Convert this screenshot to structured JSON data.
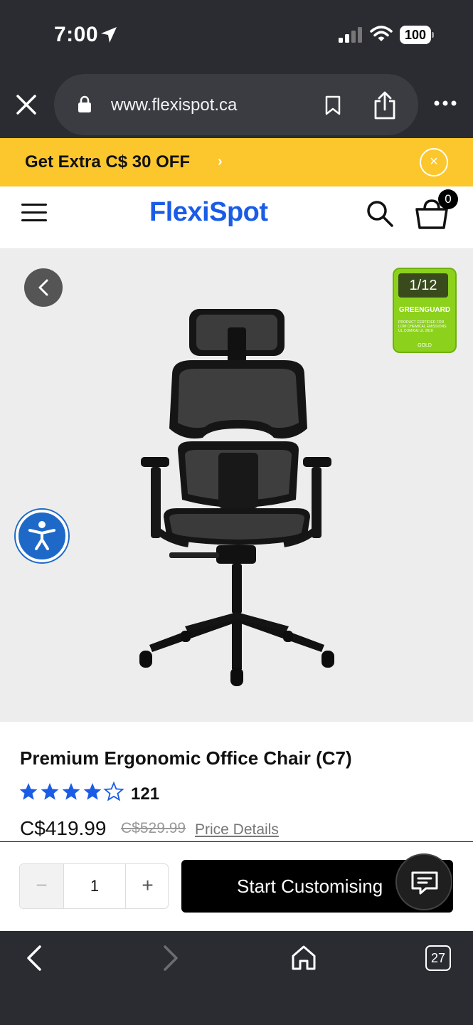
{
  "status_bar": {
    "time": "7:00",
    "battery": "100"
  },
  "browser": {
    "url": "www.flexispot.ca",
    "tab_count": "27"
  },
  "promo": {
    "text": "Get Extra C$ 30 OFF",
    "chevron": "›",
    "close": "×"
  },
  "header": {
    "logo": "FlexiSpot",
    "cart_count": "0"
  },
  "gallery": {
    "counter": "1/12",
    "badge": {
      "title": "GREENGUARD",
      "fine_print": "PRODUCT CERTIFIED FOR LOW CHEMICAL EMISSIONS UL.COM/GG UL 2818",
      "tier": "GOLD"
    }
  },
  "product": {
    "title": "Premium Ergonomic Office Chair (C7)",
    "rating": 4,
    "rating_max": 5,
    "review_count": "121",
    "price": "C$419.99",
    "old_price": "C$529.99",
    "price_details": "Price Details"
  },
  "purchase": {
    "minus": "−",
    "quantity": "1",
    "plus": "+",
    "cta": "Start Customising"
  },
  "icons": {
    "status": [
      "location-arrow-icon",
      "signal-icon",
      "wifi-icon",
      "battery-icon"
    ],
    "browser": [
      "close-icon",
      "lock-icon",
      "bookmark-icon",
      "share-icon",
      "more-icon"
    ],
    "header": [
      "menu-icon",
      "search-icon",
      "cart-icon"
    ],
    "gallery": [
      "chevron-left-icon",
      "accessibility-icon"
    ],
    "chat": "chat-icon",
    "bottom_nav": [
      "back-arrow-icon",
      "forward-arrow-icon",
      "home-icon",
      "tabs-icon"
    ]
  },
  "colors": {
    "brand_blue": "#1a5ce5",
    "promo_yellow": "#fcc72c",
    "star_blue": "#1a5ce5",
    "browser_chrome": "#2a2c31",
    "cta_black": "#000000",
    "badge_green": "#8cd11c"
  }
}
